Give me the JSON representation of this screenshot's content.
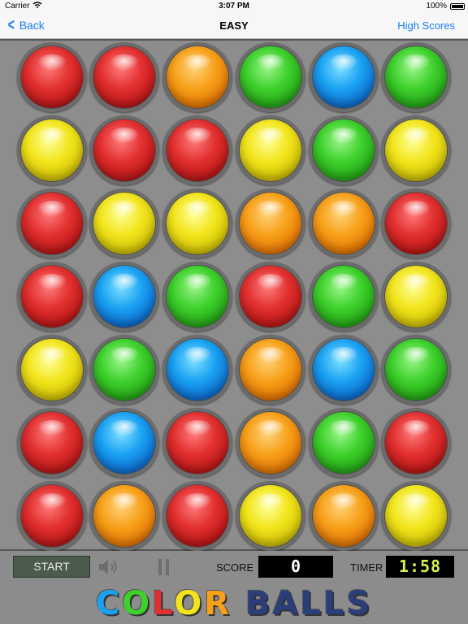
{
  "status_bar": {
    "carrier": "Carrier",
    "time": "3:07 PM",
    "battery": "100%"
  },
  "nav": {
    "back_label": "Back",
    "title": "EASY",
    "high_scores_label": "High Scores"
  },
  "board": {
    "rows": [
      [
        "red",
        "red",
        "orange",
        "green",
        "blue",
        "green"
      ],
      [
        "yellow",
        "red",
        "red",
        "yellow",
        "green",
        "yellow"
      ],
      [
        "red",
        "yellow",
        "yellow",
        "orange",
        "orange",
        "red"
      ],
      [
        "red",
        "blue",
        "green",
        "red",
        "green",
        "yellow"
      ],
      [
        "yellow",
        "green",
        "blue",
        "orange",
        "blue",
        "green"
      ],
      [
        "red",
        "blue",
        "red",
        "orange",
        "green",
        "red"
      ],
      [
        "red",
        "orange",
        "red",
        "yellow",
        "orange",
        "yellow"
      ]
    ]
  },
  "controls": {
    "start_label": "START",
    "sound_icon": "speaker-icon",
    "pause_icon": "pause-icon",
    "score_label": "SCORE",
    "score_value": "0",
    "timer_label": "TIMER",
    "timer_value": "1:58"
  },
  "logo": {
    "letters": [
      {
        "char": "C",
        "color": "#1aa2f2"
      },
      {
        "char": "O",
        "color": "#3ed12c"
      },
      {
        "char": "L",
        "color": "#e23030"
      },
      {
        "char": "O",
        "color": "#f2e51c"
      },
      {
        "char": "R",
        "color": "#f7a11a"
      },
      {
        "char": " ",
        "color": "#000000"
      },
      {
        "char": "B",
        "color": "#2a3e7a"
      },
      {
        "char": "A",
        "color": "#2a3e7a"
      },
      {
        "char": "L",
        "color": "#2a3e7a"
      },
      {
        "char": "L",
        "color": "#2a3e7a"
      },
      {
        "char": "S",
        "color": "#2a3e7a"
      }
    ]
  },
  "colors": {
    "accent": "#1a7cf5",
    "timer_digits": "#d8f04a"
  }
}
